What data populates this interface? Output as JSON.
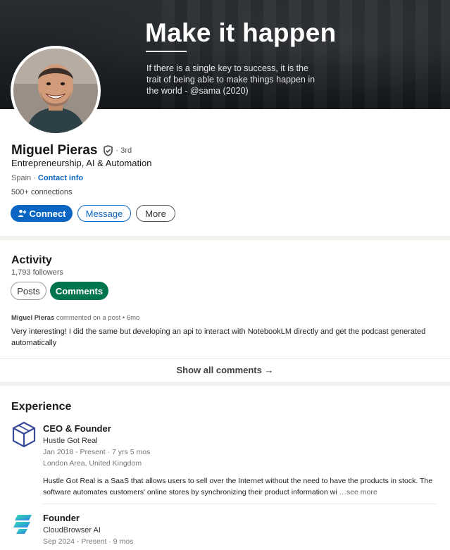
{
  "banner": {
    "title": "Make it happen",
    "quote": "If there is a single key to success, it is the trait of being able to make things happen in the world - @sama (2020)"
  },
  "profile": {
    "name": "Miguel Pieras",
    "degree": "· 3rd",
    "headline": "Entrepreneurship, AI & Automation",
    "location": "Spain · ",
    "contact_label": "Contact info",
    "connections": "500+ connections",
    "actions": {
      "connect": "Connect",
      "message": "Message",
      "more": "More"
    }
  },
  "activity": {
    "title": "Activity",
    "followers": "1,793 followers",
    "tabs": {
      "posts": "Posts",
      "comments": "Comments"
    },
    "comment": {
      "author": "Miguel Pieras",
      "meta": " commented on a post • 6mo",
      "text": "Very interesting! I did the same but developing an api to interact with NotebookLM directly and get the podcast generated automatically"
    },
    "show_all": "Show all comments →"
  },
  "experience": {
    "title": "Experience",
    "items": [
      {
        "title": "CEO & Founder",
        "company": "Hustle Got Real",
        "dates": "Jan 2018 - Present · 7 yrs 5 mos",
        "location": "London Area, United Kingdom",
        "description": "Hustle Got Real is a SaaS that allows users to sell over the Internet without the need to have the products in stock. The software automates customers' online stores by synchronizing their product information wi",
        "see_more": "…see more"
      },
      {
        "title": "Founder",
        "company": "CloudBrowser AI",
        "dates": "Sep 2024 - Present · 9 mos"
      }
    ]
  },
  "colors": {
    "primary": "#0a66c2",
    "active_tab": "#01754f",
    "page_bg": "#f4f2ee"
  }
}
